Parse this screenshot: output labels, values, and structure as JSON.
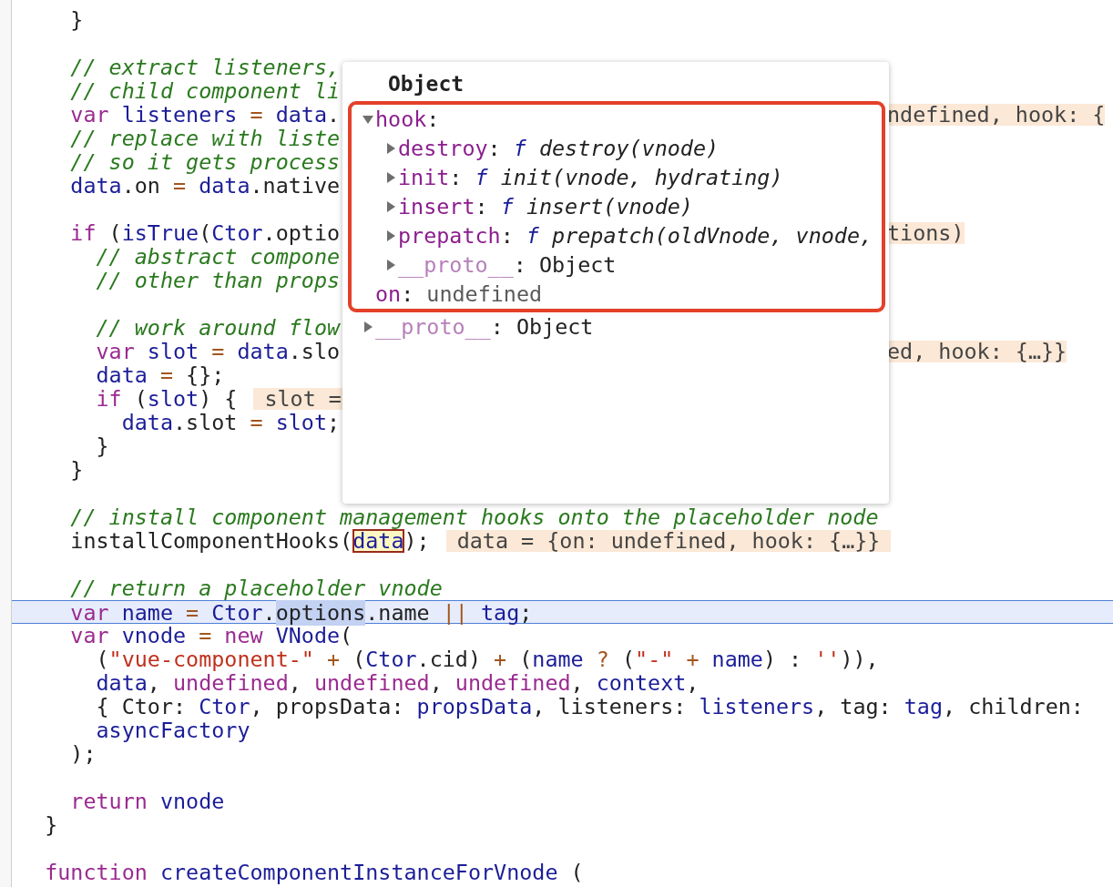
{
  "code_lines": [
    {
      "current": false,
      "segments": [
        {
          "kind": "code",
          "tokens": [
            {
              "kind": "pl",
              "text": "    }"
            }
          ]
        }
      ]
    },
    {
      "current": false
    },
    {
      "current": false,
      "segments": [
        {
          "kind": "code",
          "tokens": [
            {
              "kind": "cm",
              "text": "    // extract listeners,"
            }
          ]
        }
      ]
    },
    {
      "current": false,
      "segments": [
        {
          "kind": "code",
          "tokens": [
            {
              "kind": "cm",
              "text": "    // child component li"
            }
          ]
        }
      ]
    },
    {
      "current": false,
      "segments": [
        {
          "kind": "code",
          "tokens": [
            {
              "kind": "kw",
              "text": "    var"
            },
            {
              "kind": "id",
              "text": " listeners "
            },
            {
              "kind": "op",
              "text": "="
            },
            {
              "kind": "id",
              "text": " data"
            },
            {
              "kind": "pl",
              "text": "."
            }
          ]
        }
      ],
      "right": [
        {
          "kind": "value",
          "text": "ndefined, hook: {"
        }
      ]
    },
    {
      "current": false,
      "segments": [
        {
          "kind": "code",
          "tokens": [
            {
              "kind": "cm",
              "text": "    // replace with liste"
            }
          ]
        }
      ]
    },
    {
      "current": false,
      "segments": [
        {
          "kind": "code",
          "tokens": [
            {
              "kind": "cm",
              "text": "    // so it gets process"
            }
          ]
        }
      ]
    },
    {
      "current": false,
      "segments": [
        {
          "kind": "code",
          "tokens": [
            {
              "kind": "id",
              "text": "    data"
            },
            {
              "kind": "pl",
              "text": ".on "
            },
            {
              "kind": "op",
              "text": "="
            },
            {
              "kind": "id",
              "text": " data"
            },
            {
              "kind": "pl",
              "text": ".native"
            }
          ]
        }
      ]
    },
    {
      "current": false
    },
    {
      "current": false,
      "segments": [
        {
          "kind": "code",
          "tokens": [
            {
              "kind": "kw",
              "text": "    if"
            },
            {
              "kind": "pl",
              "text": " ("
            },
            {
              "kind": "id",
              "text": "isTrue"
            },
            {
              "kind": "pl",
              "text": "("
            },
            {
              "kind": "id",
              "text": "Ctor"
            },
            {
              "kind": "pl",
              "text": ".optio"
            }
          ]
        }
      ],
      "right": [
        {
          "kind": "value",
          "text": "tions)"
        }
      ]
    },
    {
      "current": false,
      "segments": [
        {
          "kind": "code",
          "tokens": [
            {
              "kind": "cm",
              "text": "      // abstract compone"
            }
          ]
        }
      ]
    },
    {
      "current": false,
      "segments": [
        {
          "kind": "code",
          "tokens": [
            {
              "kind": "cm",
              "text": "      // other than props"
            }
          ]
        }
      ]
    },
    {
      "current": false
    },
    {
      "current": false,
      "segments": [
        {
          "kind": "code",
          "tokens": [
            {
              "kind": "cm",
              "text": "      // work around flow"
            }
          ]
        }
      ]
    },
    {
      "current": false,
      "segments": [
        {
          "kind": "code",
          "tokens": [
            {
              "kind": "kw",
              "text": "      var"
            },
            {
              "kind": "id",
              "text": " slot "
            },
            {
              "kind": "op",
              "text": "="
            },
            {
              "kind": "id",
              "text": " data"
            },
            {
              "kind": "pl",
              "text": ".slo"
            }
          ]
        }
      ],
      "right": [
        {
          "kind": "value",
          "text": "ed, hook: {…}}"
        }
      ]
    },
    {
      "current": false,
      "segments": [
        {
          "kind": "code",
          "tokens": [
            {
              "kind": "id",
              "text": "      data "
            },
            {
              "kind": "op",
              "text": "="
            },
            {
              "kind": "pl",
              "text": " {};"
            }
          ]
        }
      ]
    },
    {
      "current": false,
      "segments": [
        {
          "kind": "code",
          "tokens": [
            {
              "kind": "kw",
              "text": "      if"
            },
            {
              "kind": "pl",
              "text": " ("
            },
            {
              "kind": "id",
              "text": "slot"
            },
            {
              "kind": "pl",
              "text": ") {"
            }
          ]
        },
        {
          "kind": "value",
          "text": "slot ="
        }
      ]
    },
    {
      "current": false,
      "segments": [
        {
          "kind": "code",
          "tokens": [
            {
              "kind": "id",
              "text": "        data"
            },
            {
              "kind": "pl",
              "text": ".slot "
            },
            {
              "kind": "op",
              "text": "="
            },
            {
              "kind": "id",
              "text": " slot"
            },
            {
              "kind": "pl",
              "text": ";"
            }
          ]
        }
      ]
    },
    {
      "current": false,
      "segments": [
        {
          "kind": "code",
          "tokens": [
            {
              "kind": "pl",
              "text": "      }"
            }
          ]
        }
      ]
    },
    {
      "current": false,
      "segments": [
        {
          "kind": "code",
          "tokens": [
            {
              "kind": "pl",
              "text": "    }"
            }
          ]
        }
      ]
    },
    {
      "current": false
    },
    {
      "current": false,
      "segments": [
        {
          "kind": "code",
          "tokens": [
            {
              "kind": "cm",
              "text": "    // install component management hooks onto the placeholder node"
            }
          ]
        }
      ]
    },
    {
      "current": false,
      "segments": [
        {
          "kind": "code",
          "tokens": [
            {
              "kind": "pl",
              "text": "    installComponentHooks("
            }
          ]
        },
        {
          "kind": "hover",
          "text": "data"
        },
        {
          "kind": "code",
          "tokens": [
            {
              "kind": "pl",
              "text": ");"
            }
          ]
        },
        {
          "kind": "value",
          "text": "data = {on: undefined, hook: {…}}"
        }
      ]
    },
    {
      "current": false
    },
    {
      "current": false,
      "segments": [
        {
          "kind": "code",
          "tokens": [
            {
              "kind": "cm",
              "text": "    // return a placeholder vnode"
            }
          ]
        }
      ]
    },
    {
      "current": true,
      "segments": [
        {
          "kind": "code",
          "tokens": [
            {
              "kind": "kw",
              "text": "    var"
            },
            {
              "kind": "id",
              "text": " name "
            },
            {
              "kind": "op",
              "text": "="
            },
            {
              "kind": "id",
              "text": " Ctor"
            },
            {
              "kind": "pl",
              "text": "."
            },
            {
              "kind": "sel",
              "text": "options"
            },
            {
              "kind": "pl",
              "text": ".name "
            },
            {
              "kind": "op",
              "text": "||"
            },
            {
              "kind": "id",
              "text": " tag"
            },
            {
              "kind": "pl",
              "text": ";"
            }
          ]
        }
      ]
    },
    {
      "current": false,
      "segments": [
        {
          "kind": "code",
          "tokens": [
            {
              "kind": "kw",
              "text": "    var"
            },
            {
              "kind": "id",
              "text": " vnode "
            },
            {
              "kind": "op",
              "text": "="
            },
            {
              "kind": "kw",
              "text": " new"
            },
            {
              "kind": "id",
              "text": " VNode"
            },
            {
              "kind": "pl",
              "text": "("
            }
          ]
        }
      ]
    },
    {
      "current": false,
      "segments": [
        {
          "kind": "code",
          "tokens": [
            {
              "kind": "pl",
              "text": "      ("
            },
            {
              "kind": "str",
              "text": "\"vue-component-\""
            },
            {
              "kind": "op",
              "text": " + "
            },
            {
              "kind": "pl",
              "text": "("
            },
            {
              "kind": "id",
              "text": "Ctor"
            },
            {
              "kind": "pl",
              "text": ".cid) "
            },
            {
              "kind": "op",
              "text": "+"
            },
            {
              "kind": "pl",
              "text": " ("
            },
            {
              "kind": "id",
              "text": "name "
            },
            {
              "kind": "op",
              "text": "?"
            },
            {
              "kind": "pl",
              "text": " ("
            },
            {
              "kind": "str",
              "text": "\"-\""
            },
            {
              "kind": "op",
              "text": " + "
            },
            {
              "kind": "id",
              "text": "name"
            },
            {
              "kind": "pl",
              "text": ") : "
            },
            {
              "kind": "str",
              "text": "''"
            },
            {
              "kind": "pl",
              "text": ")),"
            }
          ]
        }
      ]
    },
    {
      "current": false,
      "segments": [
        {
          "kind": "code",
          "tokens": [
            {
              "kind": "id",
              "text": "      data"
            },
            {
              "kind": "pl",
              "text": ", "
            },
            {
              "kind": "kw",
              "text": "undefined"
            },
            {
              "kind": "pl",
              "text": ", "
            },
            {
              "kind": "kw",
              "text": "undefined"
            },
            {
              "kind": "pl",
              "text": ", "
            },
            {
              "kind": "kw",
              "text": "undefined"
            },
            {
              "kind": "pl",
              "text": ", "
            },
            {
              "kind": "id",
              "text": "context"
            },
            {
              "kind": "pl",
              "text": ","
            }
          ]
        }
      ]
    },
    {
      "current": false,
      "segments": [
        {
          "kind": "code",
          "tokens": [
            {
              "kind": "pl",
              "text": "      { Ctor: "
            },
            {
              "kind": "id",
              "text": "Ctor"
            },
            {
              "kind": "pl",
              "text": ", propsData: "
            },
            {
              "kind": "id",
              "text": "propsData"
            },
            {
              "kind": "pl",
              "text": ", listeners: "
            },
            {
              "kind": "id",
              "text": "listeners"
            },
            {
              "kind": "pl",
              "text": ", tag: "
            },
            {
              "kind": "id",
              "text": "tag"
            },
            {
              "kind": "pl",
              "text": ", children:"
            }
          ]
        }
      ]
    },
    {
      "current": false,
      "segments": [
        {
          "kind": "code",
          "tokens": [
            {
              "kind": "id",
              "text": "      asyncFactory"
            }
          ]
        }
      ]
    },
    {
      "current": false,
      "segments": [
        {
          "kind": "code",
          "tokens": [
            {
              "kind": "pl",
              "text": "    );"
            }
          ]
        }
      ]
    },
    {
      "current": false
    },
    {
      "current": false,
      "segments": [
        {
          "kind": "code",
          "tokens": [
            {
              "kind": "kw",
              "text": "    return"
            },
            {
              "kind": "id",
              "text": " vnode"
            }
          ]
        }
      ]
    },
    {
      "current": false,
      "segments": [
        {
          "kind": "code",
          "tokens": [
            {
              "kind": "pl",
              "text": "  }"
            }
          ]
        }
      ]
    },
    {
      "current": false
    },
    {
      "current": false,
      "segments": [
        {
          "kind": "code",
          "tokens": [
            {
              "kind": "kw",
              "text": "  function"
            },
            {
              "kind": "id",
              "text": " createComponentInstanceForVnode"
            },
            {
              "kind": "pl",
              "text": " ("
            }
          ]
        }
      ]
    }
  ],
  "popover": {
    "title": "Object",
    "framed_items": [
      {
        "key": "hook",
        "separator": ":",
        "enumerable": true,
        "kind": "group",
        "expanded": true,
        "children": [
          {
            "key": "destroy",
            "separator": ":",
            "enumerable": true,
            "kind": "function",
            "value_prefix": "f",
            "value": "destroy(vnode)",
            "expanded": false
          },
          {
            "key": "init",
            "separator": ":",
            "enumerable": true,
            "kind": "function",
            "value_prefix": "f",
            "value": "init(vnode, hydrating)",
            "expanded": false
          },
          {
            "key": "insert",
            "separator": ":",
            "enumerable": true,
            "kind": "function",
            "value_prefix": "f",
            "value": "insert(vnode)",
            "expanded": false
          },
          {
            "key": "prepatch",
            "separator": ":",
            "enumerable": true,
            "kind": "function",
            "value_prefix": "f",
            "value": "prepatch(oldVnode, vnode,",
            "expanded": false
          },
          {
            "key": "__proto__",
            "separator": ":",
            "enumerable": false,
            "kind": "object",
            "value": "Object",
            "expanded": false
          }
        ]
      },
      {
        "key": "on",
        "separator": ":",
        "enumerable": true,
        "kind": "undefined",
        "value": "undefined"
      }
    ],
    "items": [
      {
        "key": "__proto__",
        "separator": ":",
        "enumerable": false,
        "kind": "object",
        "value": "Object",
        "expanded": false
      }
    ]
  }
}
